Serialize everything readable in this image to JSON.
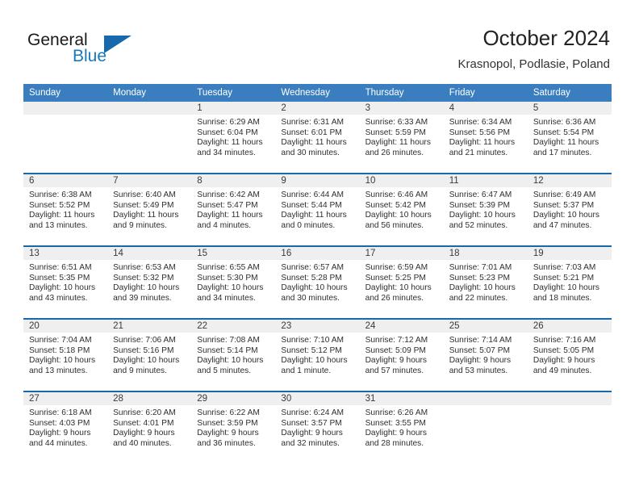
{
  "brand": {
    "name_primary": "General",
    "name_secondary": "Blue",
    "accent_color": "#1868ae"
  },
  "header": {
    "title": "October 2024",
    "subtitle": "Krasnopol, Podlasie, Poland"
  },
  "calendar": {
    "header_bg": "#3b7ec0",
    "daynum_bg": "#efefef",
    "separator_color": "#1868ae",
    "weekday_headers": [
      "Sunday",
      "Monday",
      "Tuesday",
      "Wednesday",
      "Thursday",
      "Friday",
      "Saturday"
    ],
    "labels": {
      "sunrise_prefix": "Sunrise:",
      "sunset_prefix": "Sunset:",
      "daylight_prefix": "Daylight:"
    },
    "weeks": [
      [
        {
          "day": "",
          "sunrise": "",
          "sunset": "",
          "daylight_line1": "",
          "daylight_line2": ""
        },
        {
          "day": "",
          "sunrise": "",
          "sunset": "",
          "daylight_line1": "",
          "daylight_line2": ""
        },
        {
          "day": "1",
          "sunrise": "Sunrise: 6:29 AM",
          "sunset": "Sunset: 6:04 PM",
          "daylight_line1": "Daylight: 11 hours",
          "daylight_line2": "and 34 minutes."
        },
        {
          "day": "2",
          "sunrise": "Sunrise: 6:31 AM",
          "sunset": "Sunset: 6:01 PM",
          "daylight_line1": "Daylight: 11 hours",
          "daylight_line2": "and 30 minutes."
        },
        {
          "day": "3",
          "sunrise": "Sunrise: 6:33 AM",
          "sunset": "Sunset: 5:59 PM",
          "daylight_line1": "Daylight: 11 hours",
          "daylight_line2": "and 26 minutes."
        },
        {
          "day": "4",
          "sunrise": "Sunrise: 6:34 AM",
          "sunset": "Sunset: 5:56 PM",
          "daylight_line1": "Daylight: 11 hours",
          "daylight_line2": "and 21 minutes."
        },
        {
          "day": "5",
          "sunrise": "Sunrise: 6:36 AM",
          "sunset": "Sunset: 5:54 PM",
          "daylight_line1": "Daylight: 11 hours",
          "daylight_line2": "and 17 minutes."
        }
      ],
      [
        {
          "day": "6",
          "sunrise": "Sunrise: 6:38 AM",
          "sunset": "Sunset: 5:52 PM",
          "daylight_line1": "Daylight: 11 hours",
          "daylight_line2": "and 13 minutes."
        },
        {
          "day": "7",
          "sunrise": "Sunrise: 6:40 AM",
          "sunset": "Sunset: 5:49 PM",
          "daylight_line1": "Daylight: 11 hours",
          "daylight_line2": "and 9 minutes."
        },
        {
          "day": "8",
          "sunrise": "Sunrise: 6:42 AM",
          "sunset": "Sunset: 5:47 PM",
          "daylight_line1": "Daylight: 11 hours",
          "daylight_line2": "and 4 minutes."
        },
        {
          "day": "9",
          "sunrise": "Sunrise: 6:44 AM",
          "sunset": "Sunset: 5:44 PM",
          "daylight_line1": "Daylight: 11 hours",
          "daylight_line2": "and 0 minutes."
        },
        {
          "day": "10",
          "sunrise": "Sunrise: 6:46 AM",
          "sunset": "Sunset: 5:42 PM",
          "daylight_line1": "Daylight: 10 hours",
          "daylight_line2": "and 56 minutes."
        },
        {
          "day": "11",
          "sunrise": "Sunrise: 6:47 AM",
          "sunset": "Sunset: 5:39 PM",
          "daylight_line1": "Daylight: 10 hours",
          "daylight_line2": "and 52 minutes."
        },
        {
          "day": "12",
          "sunrise": "Sunrise: 6:49 AM",
          "sunset": "Sunset: 5:37 PM",
          "daylight_line1": "Daylight: 10 hours",
          "daylight_line2": "and 47 minutes."
        }
      ],
      [
        {
          "day": "13",
          "sunrise": "Sunrise: 6:51 AM",
          "sunset": "Sunset: 5:35 PM",
          "daylight_line1": "Daylight: 10 hours",
          "daylight_line2": "and 43 minutes."
        },
        {
          "day": "14",
          "sunrise": "Sunrise: 6:53 AM",
          "sunset": "Sunset: 5:32 PM",
          "daylight_line1": "Daylight: 10 hours",
          "daylight_line2": "and 39 minutes."
        },
        {
          "day": "15",
          "sunrise": "Sunrise: 6:55 AM",
          "sunset": "Sunset: 5:30 PM",
          "daylight_line1": "Daylight: 10 hours",
          "daylight_line2": "and 34 minutes."
        },
        {
          "day": "16",
          "sunrise": "Sunrise: 6:57 AM",
          "sunset": "Sunset: 5:28 PM",
          "daylight_line1": "Daylight: 10 hours",
          "daylight_line2": "and 30 minutes."
        },
        {
          "day": "17",
          "sunrise": "Sunrise: 6:59 AM",
          "sunset": "Sunset: 5:25 PM",
          "daylight_line1": "Daylight: 10 hours",
          "daylight_line2": "and 26 minutes."
        },
        {
          "day": "18",
          "sunrise": "Sunrise: 7:01 AM",
          "sunset": "Sunset: 5:23 PM",
          "daylight_line1": "Daylight: 10 hours",
          "daylight_line2": "and 22 minutes."
        },
        {
          "day": "19",
          "sunrise": "Sunrise: 7:03 AM",
          "sunset": "Sunset: 5:21 PM",
          "daylight_line1": "Daylight: 10 hours",
          "daylight_line2": "and 18 minutes."
        }
      ],
      [
        {
          "day": "20",
          "sunrise": "Sunrise: 7:04 AM",
          "sunset": "Sunset: 5:18 PM",
          "daylight_line1": "Daylight: 10 hours",
          "daylight_line2": "and 13 minutes."
        },
        {
          "day": "21",
          "sunrise": "Sunrise: 7:06 AM",
          "sunset": "Sunset: 5:16 PM",
          "daylight_line1": "Daylight: 10 hours",
          "daylight_line2": "and 9 minutes."
        },
        {
          "day": "22",
          "sunrise": "Sunrise: 7:08 AM",
          "sunset": "Sunset: 5:14 PM",
          "daylight_line1": "Daylight: 10 hours",
          "daylight_line2": "and 5 minutes."
        },
        {
          "day": "23",
          "sunrise": "Sunrise: 7:10 AM",
          "sunset": "Sunset: 5:12 PM",
          "daylight_line1": "Daylight: 10 hours",
          "daylight_line2": "and 1 minute."
        },
        {
          "day": "24",
          "sunrise": "Sunrise: 7:12 AM",
          "sunset": "Sunset: 5:09 PM",
          "daylight_line1": "Daylight: 9 hours",
          "daylight_line2": "and 57 minutes."
        },
        {
          "day": "25",
          "sunrise": "Sunrise: 7:14 AM",
          "sunset": "Sunset: 5:07 PM",
          "daylight_line1": "Daylight: 9 hours",
          "daylight_line2": "and 53 minutes."
        },
        {
          "day": "26",
          "sunrise": "Sunrise: 7:16 AM",
          "sunset": "Sunset: 5:05 PM",
          "daylight_line1": "Daylight: 9 hours",
          "daylight_line2": "and 49 minutes."
        }
      ],
      [
        {
          "day": "27",
          "sunrise": "Sunrise: 6:18 AM",
          "sunset": "Sunset: 4:03 PM",
          "daylight_line1": "Daylight: 9 hours",
          "daylight_line2": "and 44 minutes."
        },
        {
          "day": "28",
          "sunrise": "Sunrise: 6:20 AM",
          "sunset": "Sunset: 4:01 PM",
          "daylight_line1": "Daylight: 9 hours",
          "daylight_line2": "and 40 minutes."
        },
        {
          "day": "29",
          "sunrise": "Sunrise: 6:22 AM",
          "sunset": "Sunset: 3:59 PM",
          "daylight_line1": "Daylight: 9 hours",
          "daylight_line2": "and 36 minutes."
        },
        {
          "day": "30",
          "sunrise": "Sunrise: 6:24 AM",
          "sunset": "Sunset: 3:57 PM",
          "daylight_line1": "Daylight: 9 hours",
          "daylight_line2": "and 32 minutes."
        },
        {
          "day": "31",
          "sunrise": "Sunrise: 6:26 AM",
          "sunset": "Sunset: 3:55 PM",
          "daylight_line1": "Daylight: 9 hours",
          "daylight_line2": "and 28 minutes."
        },
        {
          "day": "",
          "sunrise": "",
          "sunset": "",
          "daylight_line1": "",
          "daylight_line2": ""
        },
        {
          "day": "",
          "sunrise": "",
          "sunset": "",
          "daylight_line1": "",
          "daylight_line2": ""
        }
      ]
    ]
  }
}
